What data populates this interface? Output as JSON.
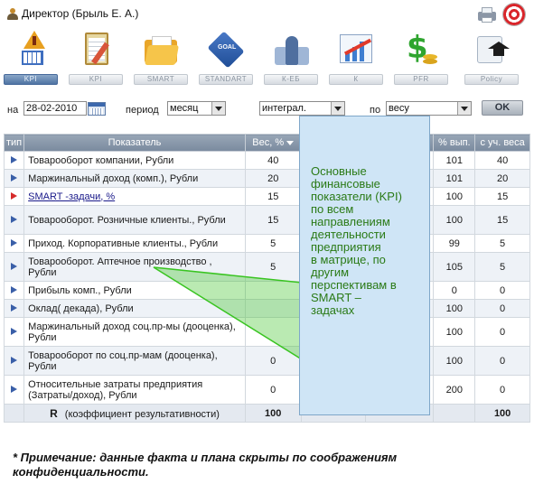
{
  "titlebar": {
    "title": "Директор   (Брыль Е. А.)",
    "icons": [
      "user-icon",
      "printer-icon",
      "target-icon"
    ]
  },
  "toolbar": {
    "tabs": [
      {
        "label": "KPI",
        "icon": "kpi-warning-icon",
        "active": true
      },
      {
        "label": "KPI",
        "icon": "clipboard-icon",
        "active": false
      },
      {
        "label": "SMART",
        "icon": "folder-icon",
        "active": false
      },
      {
        "label": "STANDART",
        "icon": "goal-icon",
        "active": false
      },
      {
        "label": "К-ЕБ",
        "icon": "chess-icon",
        "active": false
      },
      {
        "label": "К",
        "icon": "growth-chart-icon",
        "active": false
      },
      {
        "label": "PFR",
        "icon": "money-icon",
        "active": false
      },
      {
        "label": "Policy",
        "icon": "graduation-cap-icon",
        "active": false
      }
    ]
  },
  "filters": {
    "date_label": "на",
    "date_value": "28-02-2010",
    "period_label": "период",
    "period_value": "месяц",
    "mode_value": "интеграл.",
    "by_label": "по",
    "by_value": "весу",
    "ok_label": "OK"
  },
  "table": {
    "headers": {
      "type": "тип",
      "indicator": "Показатель",
      "weight": "Вес, %",
      "pct_done": "% вып.",
      "weighted": "с уч. веса"
    },
    "rows": [
      {
        "indicator": "Товарооборот компании, Рубли",
        "weight": "40",
        "pct_done": "101",
        "weighted": "40",
        "marker": "blue"
      },
      {
        "indicator": "Маржинальный доход (комп.), Рубли",
        "weight": "20",
        "pct_done": "101",
        "weighted": "20",
        "marker": "blue"
      },
      {
        "indicator": "SMART -задачи, %",
        "weight": "15",
        "pct_done": "100",
        "weighted": "15",
        "marker": "red",
        "link": true
      },
      {
        "indicator": "Товарооборот. Розничные клиенты., Рубли",
        "weight": "15",
        "pct_done": "100",
        "weighted": "15",
        "marker": "blue"
      },
      {
        "indicator": "Приход. Корпоративные клиенты., Рубли",
        "weight": "5",
        "pct_done": "99",
        "weighted": "5",
        "marker": "blue"
      },
      {
        "indicator": "Товарооборот. Аптечное производство , Рубли",
        "weight": "5",
        "pct_done": "105",
        "weighted": "5",
        "marker": "blue"
      },
      {
        "indicator": "Прибыль комп., Рубли",
        "weight": "",
        "pct_done": "0",
        "weighted": "0",
        "marker": "blue"
      },
      {
        "indicator": "Оклад( декада), Рубли",
        "weight": "",
        "pct_done": "100",
        "weighted": "0",
        "marker": "blue"
      },
      {
        "indicator": "Маржинальный доход соц.пр-мы (дооценка), Рубли",
        "weight": "",
        "pct_done": "100",
        "weighted": "0",
        "marker": "blue"
      },
      {
        "indicator": "Товарооборот по соц.пр-мам (дооценка), Рубли",
        "weight": "0",
        "pct_done": "100",
        "weighted": "0",
        "marker": "blue"
      },
      {
        "indicator": "Относительные затраты предприятия (Затраты/доход), Рубли",
        "weight": "0",
        "pct_done": "200",
        "weighted": "0",
        "marker": "blue"
      }
    ],
    "total": {
      "letter": "R",
      "label": "(коэффициент результативности)",
      "weight": "100",
      "weighted": "100"
    }
  },
  "callout": {
    "lines": [
      "Основные",
      "финансовые",
      "показатели (KPI)",
      "по всем",
      "направлениям",
      "деятельности",
      "предприятия",
      "в матрице, по",
      "другим",
      "перспективам в",
      "SMART –",
      "задачах"
    ],
    "color": "#2a7a16",
    "background": "#cfe5f6"
  },
  "footnote": {
    "text": "* Примечание: данные факта и плана скрыты по соображениям конфиденциальности."
  },
  "colors": {
    "header": "#8898ac",
    "active_tab": "#4f74a3",
    "row_alt": "#eef2f7",
    "marker_blue": "#3a5fa8",
    "marker_red": "#d62b2b",
    "callout_line": "#39c421"
  }
}
